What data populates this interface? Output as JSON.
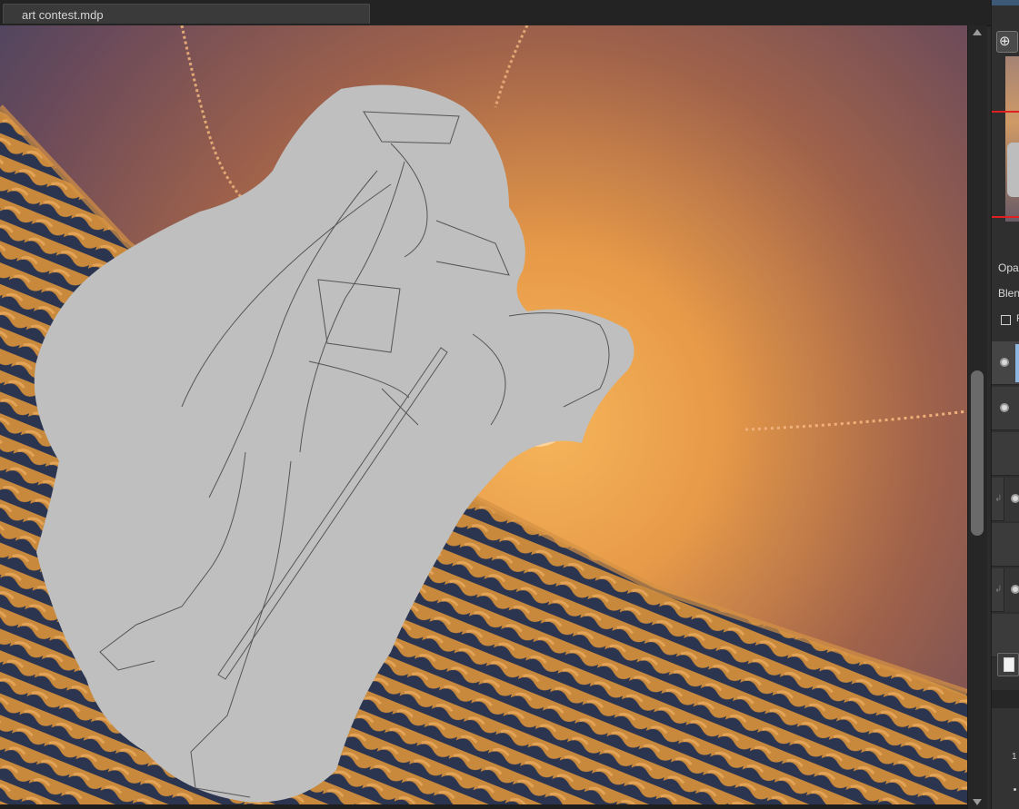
{
  "app": {
    "document_tab": "art contest.mdp"
  },
  "right_panel": {
    "zoom_icon": "zoom-in-icon",
    "opacity_label": "Opa",
    "blend_label": "Blen",
    "protect_checkbox_label": "P",
    "layer_count_label": "1"
  },
  "colors": {
    "accent": "#8fb6e0",
    "navigator_frame": "#e02020",
    "canvas_sky_top": "#5a4a66",
    "canvas_glow": "#f0a048",
    "silhouette": "#bfbfbf"
  }
}
